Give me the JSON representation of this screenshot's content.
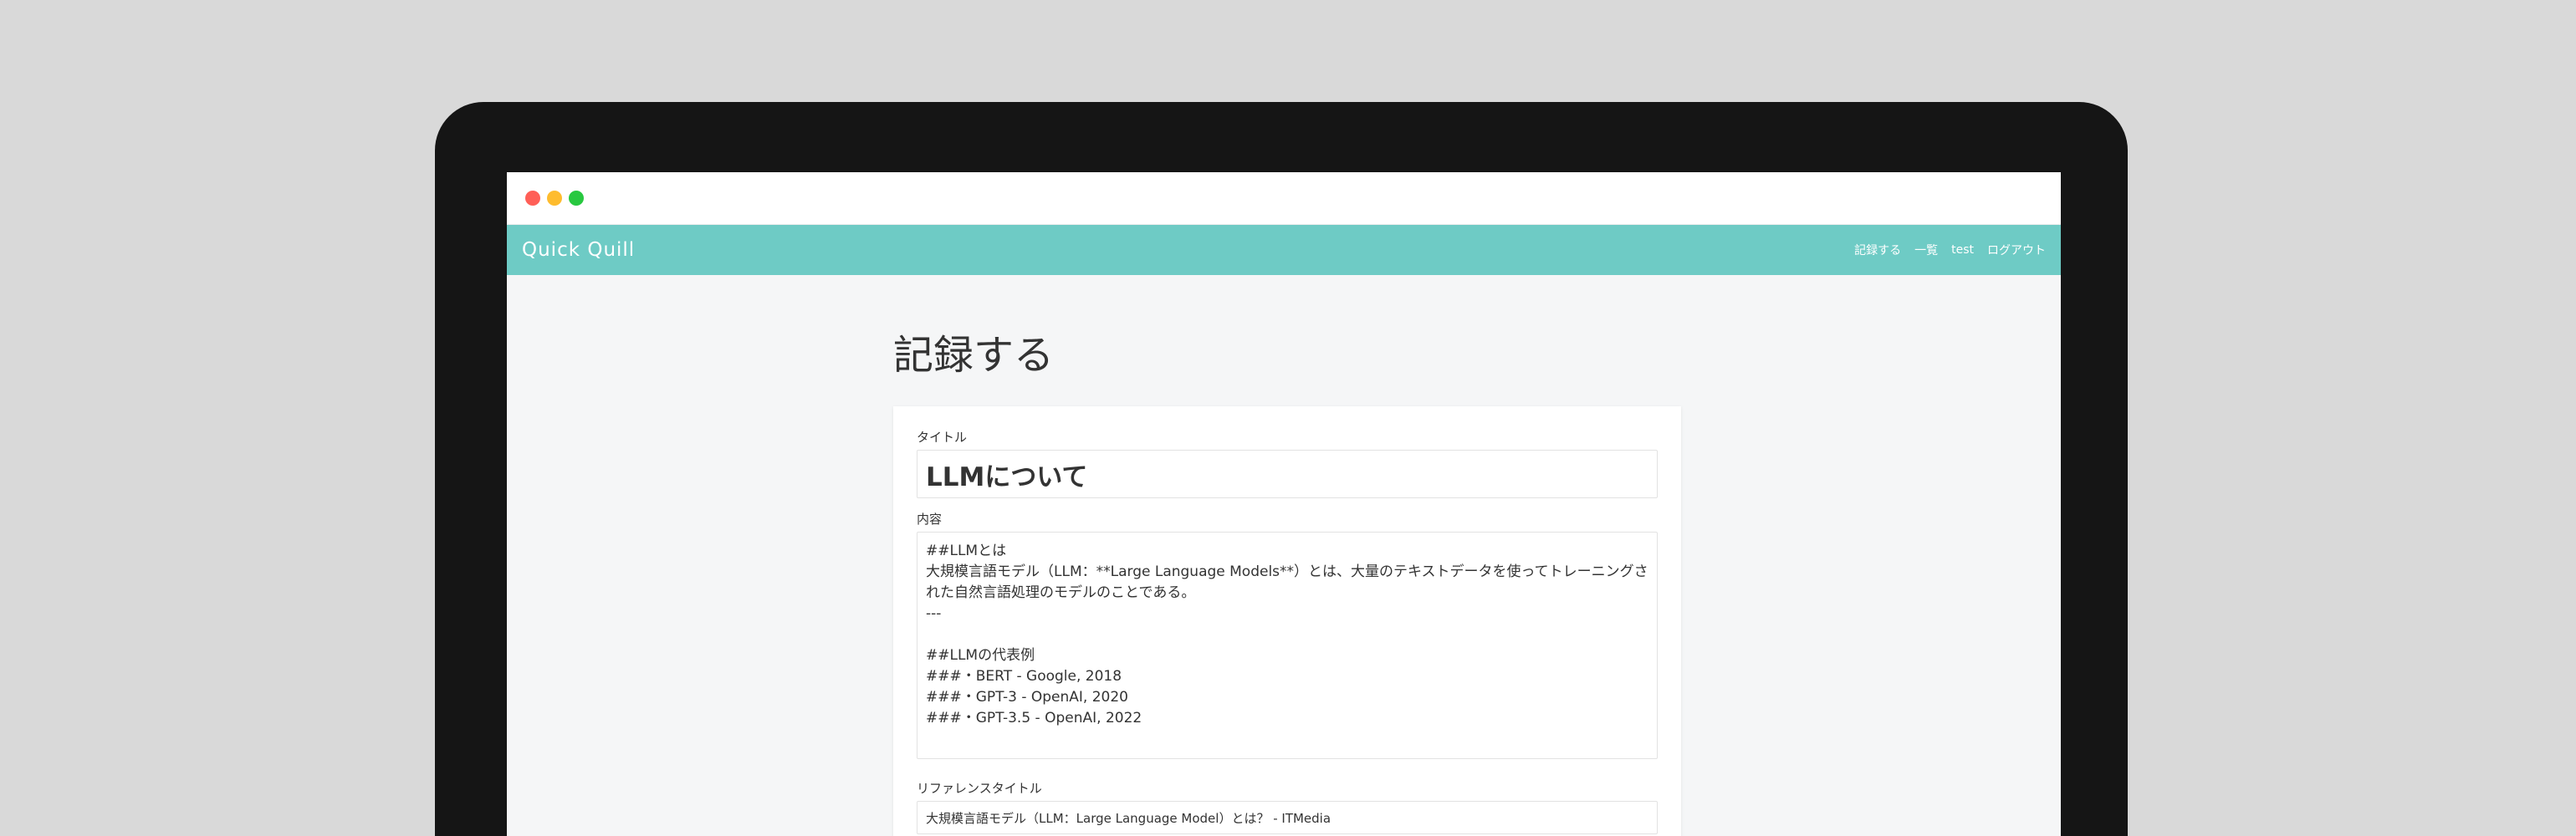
{
  "window": {
    "controls": [
      "close",
      "minimize",
      "maximize"
    ]
  },
  "navbar": {
    "brand": "Quick Quill",
    "links": [
      {
        "label": "記録する"
      },
      {
        "label": "一覧"
      },
      {
        "label": "test"
      },
      {
        "label": "ログアウト"
      }
    ],
    "background_color": "#6ecbc5"
  },
  "page": {
    "title": "記録する"
  },
  "form": {
    "title_label": "タイトル",
    "title_value": "LLMについて",
    "content_label": "内容",
    "content_value": "##LLMとは\n大規模言語モデル（LLM：**Large Language Models**）とは、大量のテキストデータを使ってトレーニングされた自然言語処理のモデルのことである。\n---\n\n##LLMの代表例\n###・BERT - Google, 2018\n###・GPT-3 - OpenAI, 2020\n###・GPT-3.5 - OpenAI, 2022",
    "reference_title_label": "リファレンスタイトル",
    "reference_title_value": "大規模言語モデル（LLM：Large Language Model）とは？ - ITMedia"
  }
}
